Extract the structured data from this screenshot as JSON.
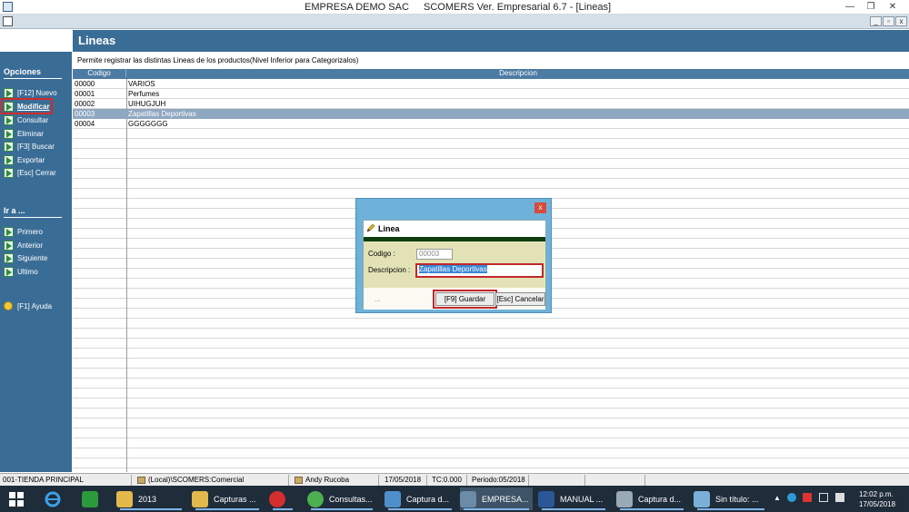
{
  "window": {
    "title_left": "EMPRESA DEMO SAC",
    "title_right": "SCOMERS Ver. Empresarial  6.7 - [Lineas]",
    "minimize": "—",
    "restore": "❐",
    "close": "✕"
  },
  "mdi": {
    "min": "_",
    "restore": "▫",
    "close": "x"
  },
  "sidebar": {
    "options_title": "Opciones",
    "options": [
      {
        "label": "[F12] Nuevo"
      },
      {
        "label": "Modificar"
      },
      {
        "label": "Consultar"
      },
      {
        "label": "Eliminar"
      },
      {
        "label": "[F3] Buscar"
      },
      {
        "label": "Exportar"
      },
      {
        "label": "[Esc] Cerrar"
      }
    ],
    "goto_title": "Ir a ...",
    "goto": [
      {
        "label": "Primero"
      },
      {
        "label": "Anterior"
      },
      {
        "label": "Siguiente"
      },
      {
        "label": "Ultimo"
      }
    ],
    "help": "[F1] Ayuda"
  },
  "main": {
    "title": "Lineas",
    "subtitle": "Permite registrar las distintas Lineas de los productos(Nivel Inferior para Categorizalos)",
    "columns": {
      "code": "Codigo",
      "description": "Descripcion"
    },
    "rows": [
      {
        "code": "00000",
        "description": "VARIOS"
      },
      {
        "code": "00001",
        "description": "Perfumes"
      },
      {
        "code": "00002",
        "description": "UIHUGJUH"
      },
      {
        "code": "00003",
        "description": "Zapatillas Deportivas"
      },
      {
        "code": "00004",
        "description": "GGGGGGG"
      }
    ],
    "selected_index": 3
  },
  "dialog": {
    "close": "x",
    "title": "Linea",
    "code_label": "Codigo :",
    "code_value": "00003",
    "desc_label": "Descripcion :",
    "desc_value": "Zapatillas Deportivas",
    "dots": "...",
    "save": "[F9] Guardar",
    "cancel": "[Esc] Cancelar"
  },
  "statusbar": {
    "store": "001-TIENDA PRINCIPAL",
    "db": "(Local)\\SCOMERS:Comercial",
    "user": "Andy Rucoba",
    "date": "17/05/2018",
    "tc": "TC:0.000",
    "period": "Periodo:05/2018"
  },
  "taskbar": {
    "items": [
      {
        "label": "2013",
        "color": "#e2b94a"
      },
      {
        "label": "Capturas ...",
        "color": "#e2b94a"
      },
      {
        "label": "",
        "color": "#d32f2f"
      },
      {
        "label": "Consultas...",
        "color": "#4caf50"
      },
      {
        "label": "Captura d...",
        "color": "#4f8fc9"
      },
      {
        "label": "EMPRESA...",
        "color": "#6a8ca8"
      },
      {
        "label": "MANUAL ...",
        "color": "#2b5797"
      },
      {
        "label": "Captura d...",
        "color": "#9aa9b7"
      },
      {
        "label": "Sin título: ...",
        "color": "#7ab0d8"
      }
    ],
    "time": "12:02 p.m.",
    "date": "17/05/2018"
  },
  "colors": {
    "accent": "#3a6d96",
    "grid_header": "#4c7ba3",
    "highlight_red": "#c0282a",
    "selected_row": "#8fa7c0"
  }
}
